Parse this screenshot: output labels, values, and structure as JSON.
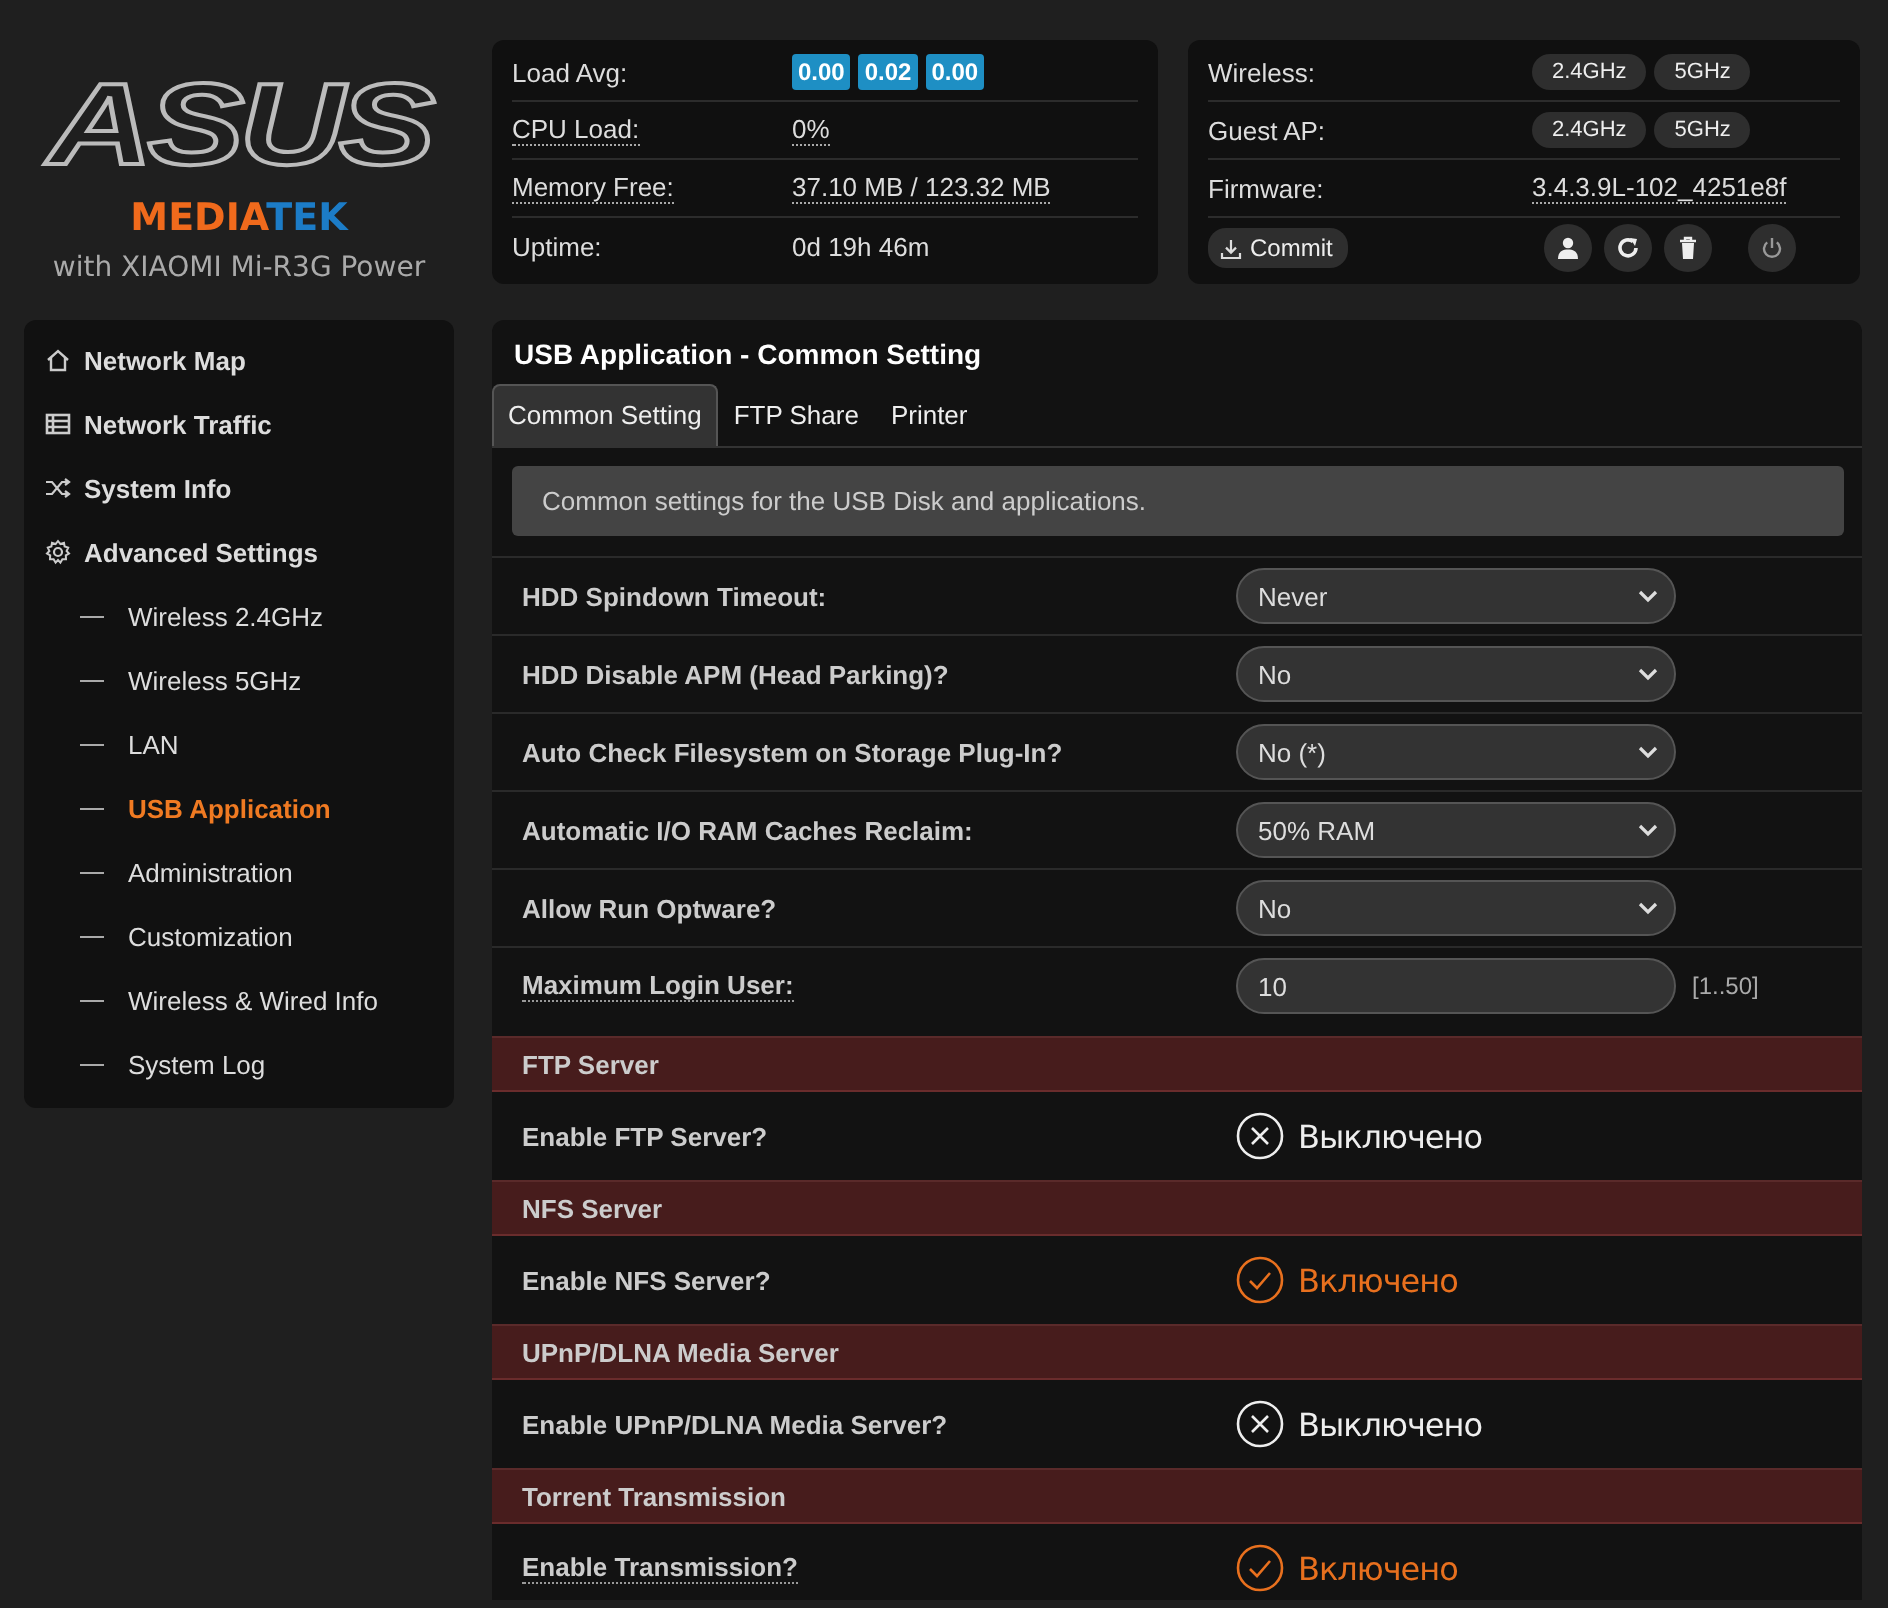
{
  "logo": {
    "brand": "ASUS",
    "chip_left": "MEDIA",
    "chip_right": "TEK",
    "tagline": "with XIAOMI Mi-R3G Power"
  },
  "status_panel": {
    "rows": [
      {
        "label": "Load Avg:",
        "kind": "badges",
        "values": [
          "0.00",
          "0.02",
          "0.00"
        ]
      },
      {
        "label": "CPU Load:",
        "kind": "link",
        "value": "0%"
      },
      {
        "label": "Memory Free:",
        "kind": "link",
        "value": "37.10 MB / 123.32 MB"
      },
      {
        "label": "Uptime:",
        "kind": "text",
        "value": "0d 19h 46m"
      }
    ]
  },
  "router_panel": {
    "rows": [
      {
        "label": "Wireless:",
        "kind": "pills",
        "values": [
          "2.4GHz",
          "5GHz"
        ]
      },
      {
        "label": "Guest AP:",
        "kind": "pills",
        "values": [
          "2.4GHz",
          "5GHz"
        ]
      },
      {
        "label": "Firmware:",
        "kind": "link",
        "value": "3.4.3.9L-102_4251e8f"
      }
    ],
    "commit_button": "Commit"
  },
  "sidebar": {
    "items": [
      {
        "label": "Network Map",
        "kind": "home",
        "selected": false
      },
      {
        "label": "Network Traffic",
        "kind": "traffic",
        "selected": false
      },
      {
        "label": "System Info",
        "kind": "shuffle",
        "selected": false
      },
      {
        "label": "Advanced Settings",
        "kind": "gear",
        "selected": false,
        "children": [
          {
            "label": "Wireless 2.4GHz",
            "selected": false
          },
          {
            "label": "Wireless 5GHz",
            "selected": false
          },
          {
            "label": "LAN",
            "selected": false
          },
          {
            "label": "USB Application",
            "selected": true
          },
          {
            "label": "Administration",
            "selected": false
          },
          {
            "label": "Customization",
            "selected": false
          },
          {
            "label": "Wireless & Wired Info",
            "selected": false
          },
          {
            "label": "System Log",
            "selected": false
          }
        ]
      }
    ]
  },
  "main": {
    "title": "USB Application - Common Setting",
    "tabs": [
      {
        "label": "Common Setting",
        "selected": true
      },
      {
        "label": "FTP Share",
        "selected": false
      },
      {
        "label": "Printer",
        "selected": false
      }
    ],
    "description": "Common settings for the USB Disk and applications.",
    "settings": [
      {
        "label": "HDD Spindown Timeout:",
        "kind": "select",
        "value": "Never",
        "hint": false
      },
      {
        "label": "HDD Disable APM (Head Parking)?",
        "kind": "select",
        "value": "No",
        "hint": false
      },
      {
        "label": "Auto Check Filesystem on Storage Plug-In?",
        "kind": "select",
        "value": "No (*)",
        "hint": false
      },
      {
        "label": "Automatic I/O RAM Caches Reclaim:",
        "kind": "select",
        "value": "50% RAM",
        "hint": false
      },
      {
        "label": "Allow Run Optware?",
        "kind": "select",
        "value": "No",
        "hint": false
      },
      {
        "label": "Maximum Login User:",
        "kind": "input",
        "value": "10",
        "range": "[1..50]",
        "hint": true
      }
    ],
    "sections": [
      {
        "title": "FTP Server",
        "rows": [
          {
            "label": "Enable FTP Server?",
            "on": false,
            "status": "Выключено",
            "hint": false
          }
        ]
      },
      {
        "title": "NFS Server",
        "rows": [
          {
            "label": "Enable NFS Server?",
            "on": true,
            "status": "Включено",
            "hint": false
          }
        ]
      },
      {
        "title": "UPnP/DLNA Media Server",
        "rows": [
          {
            "label": "Enable UPnP/DLNA Media Server?",
            "on": false,
            "status": "Выключено",
            "hint": false
          }
        ]
      },
      {
        "title": "Torrent Transmission",
        "rows": [
          {
            "label": "Enable Transmission?",
            "on": true,
            "status": "Включено",
            "hint": true
          }
        ]
      }
    ]
  }
}
